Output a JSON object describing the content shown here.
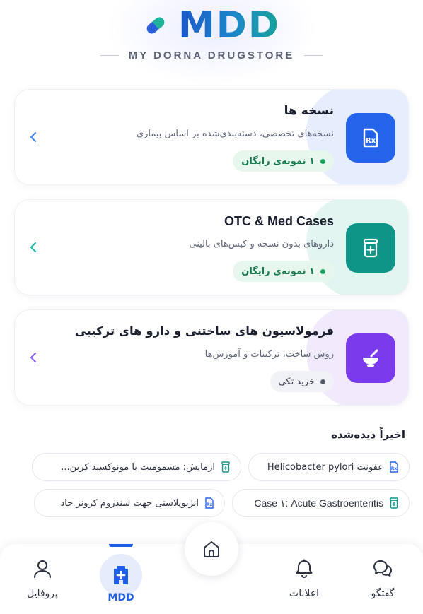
{
  "brand": {
    "logo": "MDD",
    "subtitle": "MY DORNA DRUGSTORE"
  },
  "cards": [
    {
      "title": "نسخه ها",
      "description": "نسخه‌های تخصصی، دسته‌بندی‌شده بر اساس بیماری",
      "badge": "۱ نمونه‌ی رایگان",
      "icon": "prescription-icon",
      "accent": "#2563eb"
    },
    {
      "title": "OTC & Med Cases",
      "description": "داروهای بدون نسخه و کیس‌های بالینی",
      "badge": "۱ نمونه‌ی رایگان",
      "icon": "medicine-bottle-icon",
      "accent": "#0f9488"
    },
    {
      "title": "فرمولاسیون های ساختنی و دارو های ترکیبی",
      "description": "روش ساخت، ترکیبات و آموزش‌ها",
      "badge": "خرید تکی",
      "icon": "mortar-pestle-icon",
      "accent": "#7c3aed"
    }
  ],
  "recent": {
    "title": "اخیراً دیده‌شده",
    "items": [
      {
        "label": "عفونت Helicobacter pylori",
        "icon": "prescription-icon"
      },
      {
        "label": "آزمایش: مسمومیت با مونوکسید کربن...",
        "icon": "medicine-bottle-icon"
      },
      {
        "label": "Case ۱: Acute Gastroenteritis",
        "icon": "medicine-bottle-icon"
      },
      {
        "label": "آنژیوپلاستی جهت سندروم کرونر حاد",
        "icon": "prescription-icon"
      }
    ]
  },
  "nav": {
    "chat": "گفتگو",
    "notifications": "اعلانات",
    "home": "",
    "mdd": "MDD",
    "profile": "پروفایل"
  }
}
